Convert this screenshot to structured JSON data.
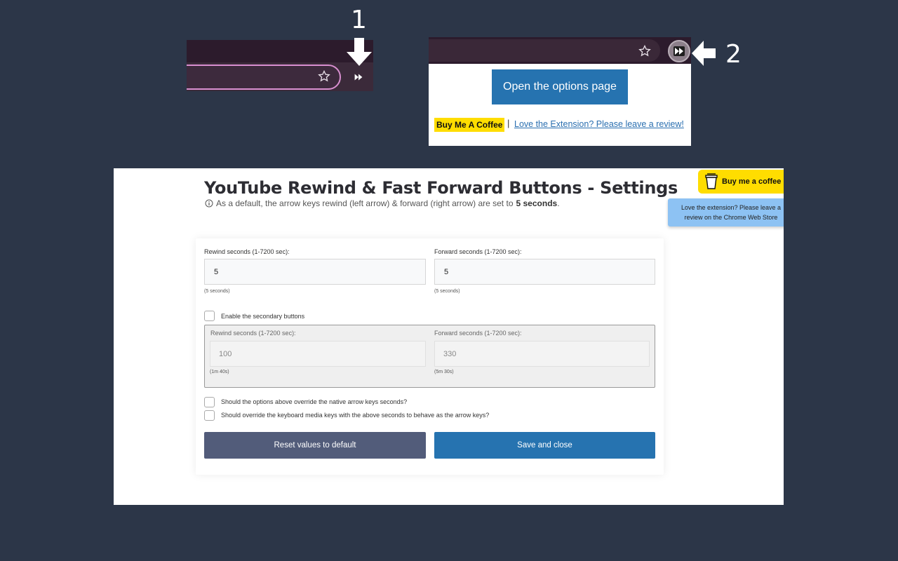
{
  "steps": {
    "one": "1",
    "two": "2"
  },
  "popup": {
    "open_options": "Open the options page",
    "coffee_badge": "Buy Me A Coffee",
    "separator": "|",
    "review_link": "Love the Extension? Please leave a review!"
  },
  "settings": {
    "title": "YouTube Rewind & Fast Forward Buttons - Settings",
    "subtitle_prefix": "As a default, the arrow keys rewind (left arrow) & forward (right arrow) are set to",
    "subtitle_bold": "5 seconds",
    "subtitle_suffix": ".",
    "bmc_label": "Buy me a coffee",
    "love_line1": "Love the extension? Please leave a",
    "love_line2": "review on the Chrome Web Store",
    "rewind_label": "Rewind seconds (1-7200 sec):",
    "forward_label": "Forward seconds (1-7200 sec):",
    "rewind_value": "5",
    "forward_value": "5",
    "rewind_hint": "(5 seconds)",
    "forward_hint": "(5 seconds)",
    "secondary_label": "Enable the secondary buttons",
    "sec_rewind_label": "Rewind seconds (1-7200 sec):",
    "sec_forward_label": "Forward seconds (1-7200 sec):",
    "sec_rewind_value": "100",
    "sec_forward_value": "330",
    "sec_rewind_hint": "(1m 40s)",
    "sec_forward_hint": "(5m 30s)",
    "override_label": "Should the options above override the native arrow keys seconds?",
    "media_label": "Should override the keyboard media keys with the above seconds to behave as the arrow keys?",
    "reset_label": "Reset values to default",
    "save_label": "Save and close"
  },
  "icons": {
    "star": "star-icon",
    "fast_forward": "fast-forward-icon",
    "info": "info-icon",
    "cup": "coffee-cup-icon"
  },
  "colors": {
    "background": "#2c3648",
    "primary": "#2673b0",
    "reset": "#525c7a",
    "coffee": "#ffdd00"
  }
}
